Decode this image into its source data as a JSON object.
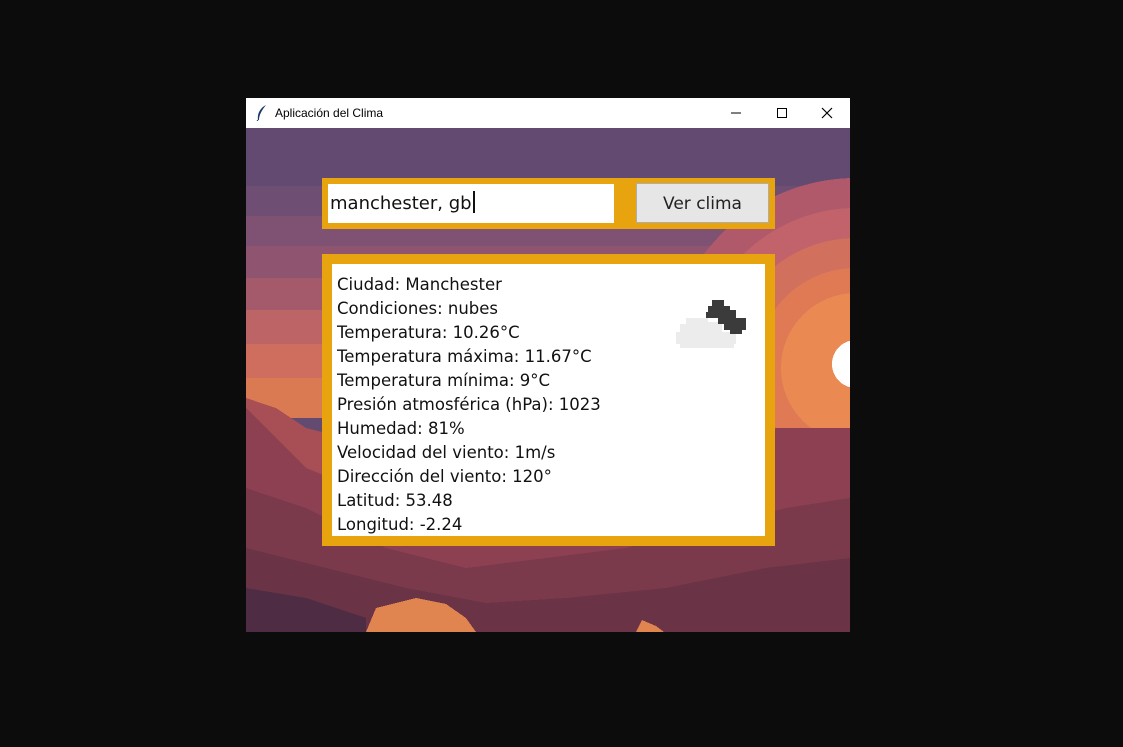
{
  "window": {
    "title": "Aplicación del Clima",
    "icons": {
      "app": "feather-icon",
      "minimize": "minimize-icon",
      "maximize": "maximize-icon",
      "close": "close-icon"
    }
  },
  "search": {
    "value": "manchester, gb",
    "button_label": "Ver clima"
  },
  "weather": {
    "icon": "cloudy-icon",
    "lines": [
      "Ciudad: Manchester",
      "Condiciones: nubes",
      "Temperatura: 10.26°C",
      "Temperatura máxima: 11.67°C",
      "Temperatura mínima: 9°C",
      "Presión atmosférica (hPa): 1023",
      "Humedad: 81%",
      "Velocidad del viento: 1m/s",
      "Dirección del viento: 120°",
      "Latitud: 53.48",
      "Longitud: -2.24"
    ]
  },
  "colors": {
    "accent_frame": "#e8a40e",
    "desktop": "#0c0c0c"
  }
}
